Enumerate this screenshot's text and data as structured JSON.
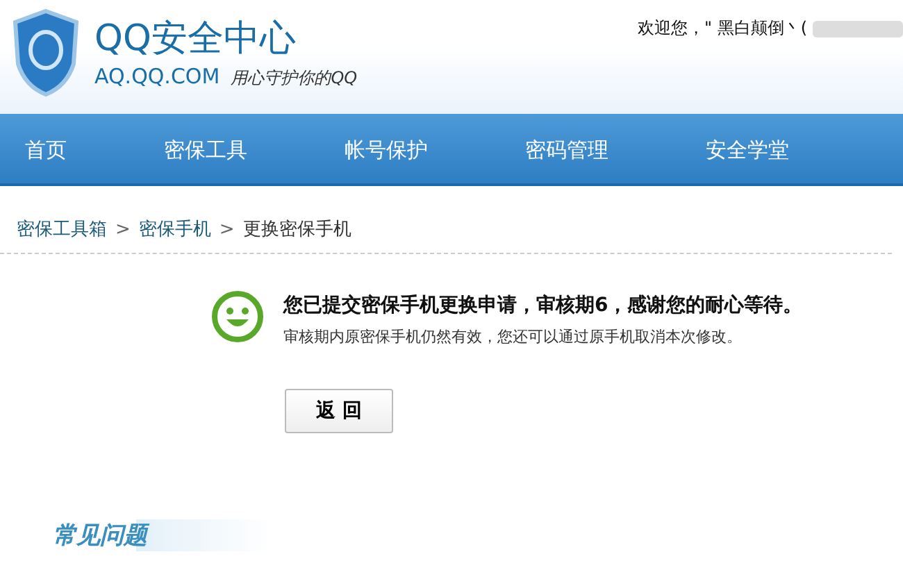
{
  "header": {
    "logo_title": "QQ安全中心",
    "logo_url": "AQ.QQ.COM",
    "slogan": "用心守护你的QQ",
    "welcome": "欢迎您，\" 黑白颠倒丶("
  },
  "nav": [
    {
      "label": "首页"
    },
    {
      "label": "密保工具"
    },
    {
      "label": "帐号保护"
    },
    {
      "label": "密码管理"
    },
    {
      "label": "安全学堂"
    }
  ],
  "breadcrumb": [
    {
      "label": "密保工具箱"
    },
    {
      "label": "密保手机"
    },
    {
      "label": "更换密保手机"
    }
  ],
  "breadcrumb_separator": ">",
  "notice": {
    "title": "您已提交密保手机更换申请，审核期6，感谢您的耐心等待。",
    "detail": "审核期内原密保手机仍然有效，您还可以通过原手机取消本次修改。"
  },
  "back_button": "返 回",
  "faq_title": "常见问题"
}
